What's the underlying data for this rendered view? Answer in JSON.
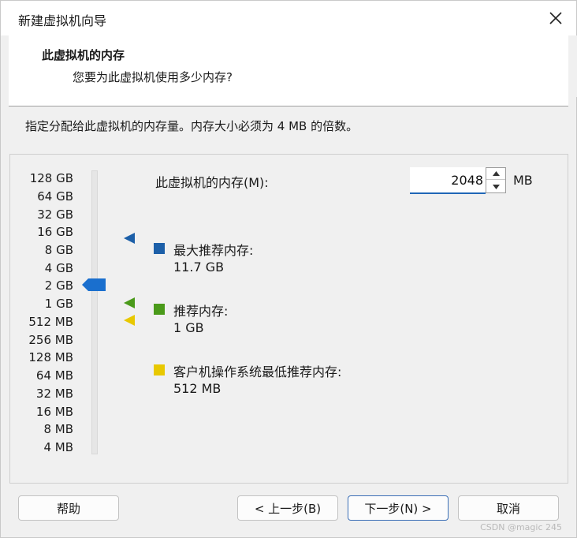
{
  "window": {
    "title": "新建虚拟机向导"
  },
  "header": {
    "title": "此虚拟机的内存",
    "subtitle": "您要为此虚拟机使用多少内存?"
  },
  "instruction": "指定分配给此虚拟机的内存量。内存大小必须为 4 MB 的倍数。",
  "scale": {
    "labels": [
      "128 GB",
      "64 GB",
      "32 GB",
      "16 GB",
      "8 GB",
      "4 GB",
      "2 GB",
      "1 GB",
      "512 MB",
      "256 MB",
      "128 MB",
      "64 MB",
      "32 MB",
      "16 MB",
      "8 MB",
      "4 MB"
    ]
  },
  "memory": {
    "label": "此虚拟机的内存(M):",
    "value": "2048",
    "unit": "MB"
  },
  "legend": {
    "max_title": "最大推荐内存:",
    "max_value": "11.7 GB",
    "rec_title": "推荐内存:",
    "rec_value": "1 GB",
    "min_title": "客户机操作系统最低推荐内存:",
    "min_value": "512 MB"
  },
  "colors": {
    "max": "#1c5fa8",
    "recommended": "#4a9a1a",
    "minimum": "#e8c800",
    "thumb": "#1a6fce"
  },
  "buttons": {
    "help": "帮助",
    "back": "< 上一步(B)",
    "next": "下一步(N) >",
    "cancel": "取消"
  },
  "watermark": "CSDN @magic 245"
}
